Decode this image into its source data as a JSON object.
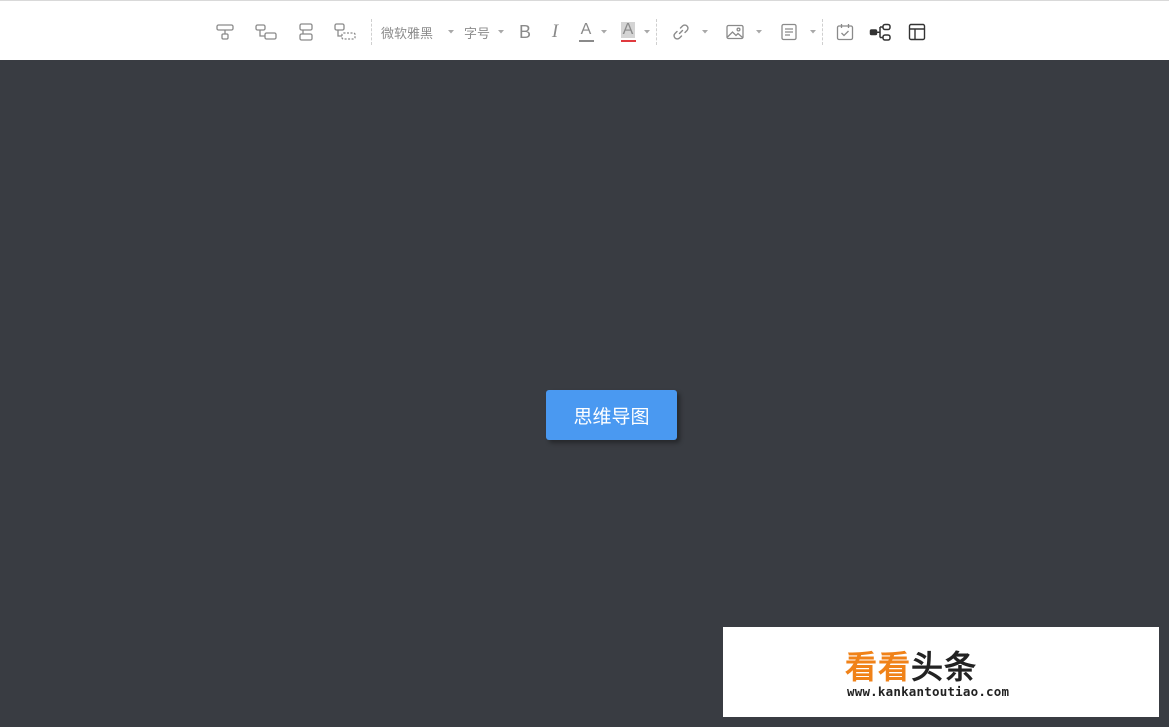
{
  "toolbar": {
    "icons": {
      "insert_sibling_node": "node-after-icon",
      "insert_child_node": "node-child-icon",
      "insert_parent_node": "node-parent-icon",
      "insert_floating_node": "node-free-icon",
      "bold": "bold-icon",
      "italic": "italic-icon",
      "font_color": "font-color-icon",
      "background_color": "background-color-icon",
      "link": "link-icon",
      "image": "image-icon",
      "note": "note-icon",
      "task": "task-calendar-icon",
      "structure": "mindmap-structure-icon",
      "layout": "layout-icon"
    },
    "font_family": "微软雅黑",
    "font_size": "字号",
    "bold_glyph": "B",
    "italic_glyph": "I",
    "font_color_glyph": "A",
    "bg_color_glyph": "A",
    "colors": {
      "icon": "#8a8a8a",
      "font_color_underline": "#8a8a8a",
      "bg_color_underline": "#e0393e",
      "bg_color_fill": "#d4d4d4",
      "active_icon": "#333333"
    }
  },
  "canvas": {
    "background": "#393c42",
    "root_node": {
      "label": "思维导图",
      "color": "#4a99f1"
    }
  },
  "watermark": {
    "title_colored": "看看",
    "title_dark": "头条",
    "url": "www.kankantoutiao.com"
  }
}
